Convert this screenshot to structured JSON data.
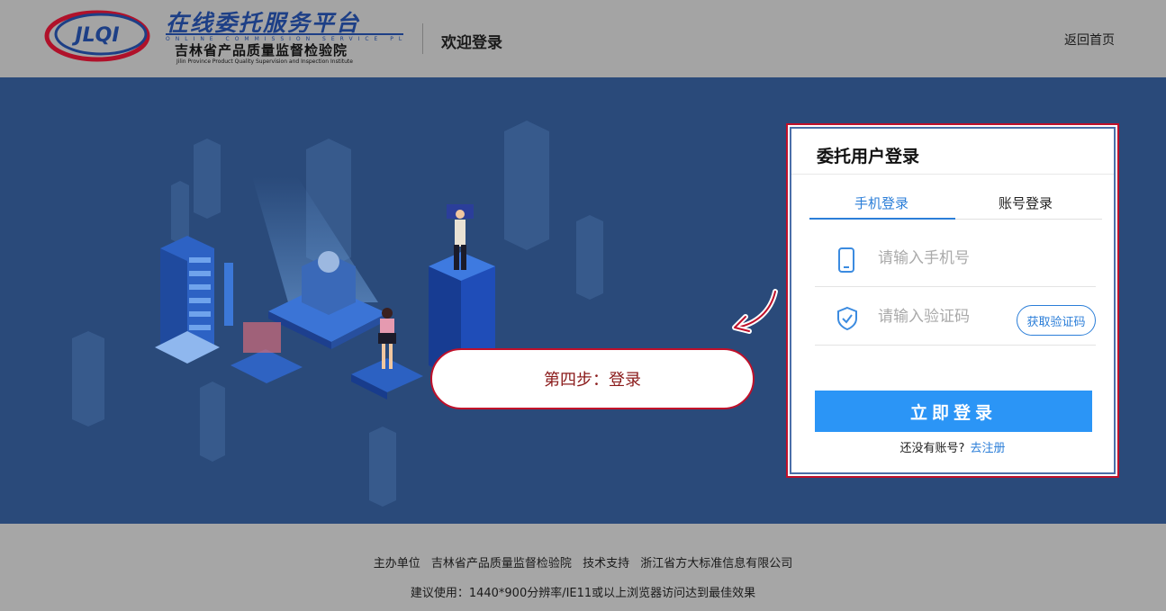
{
  "header": {
    "logo_text": "JLQI",
    "platform_title": "在线委托服务平台",
    "platform_en": "ONLINE COMMISSION SERVICE PLATFORM",
    "institute_cn": "吉林省产品质量监督检验院",
    "institute_en": "Jilin Province Product Quality Supervision and Inspection Institute",
    "welcome": "欢迎登录",
    "home_link": "返回首页"
  },
  "step_hint": "第四步：登录",
  "login": {
    "title": "委托用户登录",
    "tabs": [
      {
        "label": "手机登录",
        "active": true
      },
      {
        "label": "账号登录",
        "active": false
      }
    ],
    "phone_placeholder": "请输入手机号",
    "code_placeholder": "请输入验证码",
    "get_code_label": "获取验证码",
    "submit_label": "立即登录",
    "no_account_text": "还没有账号?",
    "register_link": "去注册"
  },
  "footer": {
    "host_label": "主办单位",
    "host_name": "吉林省产品质量监督检验院",
    "support_label": "技术支持",
    "support_name": "浙江省方大标准信息有限公司",
    "recommendation": "建议使用：1440*900分辨率/IE11或以上浏览器访问达到最佳效果"
  },
  "colors": {
    "accent": "#2b95f6",
    "link": "#2b7ed8",
    "highlight_border": "#c0102a",
    "hero_bg": "#2a4a7a"
  }
}
